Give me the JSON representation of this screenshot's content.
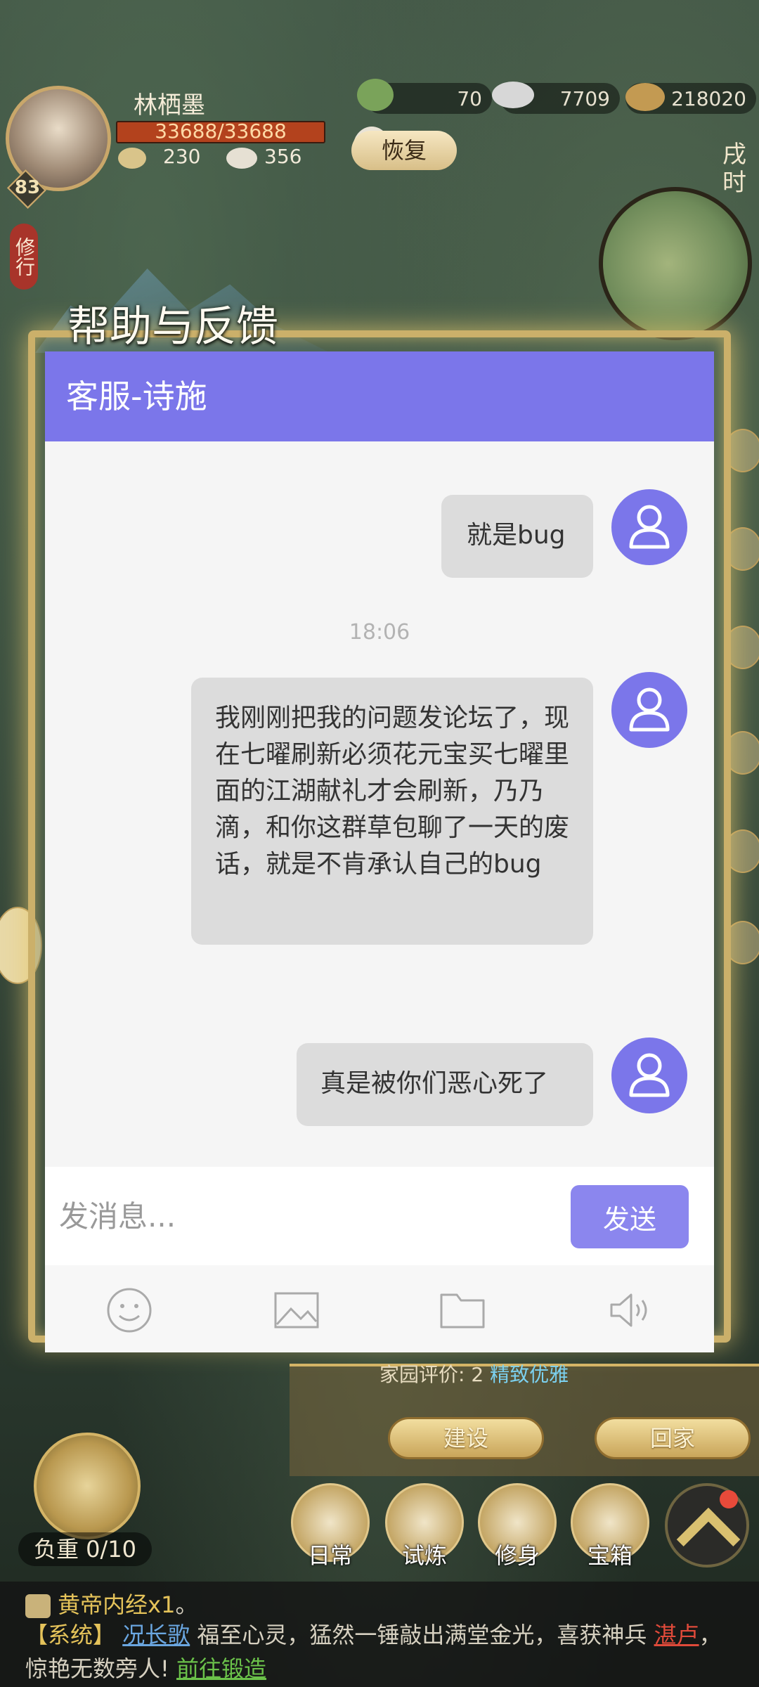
{
  "hud": {
    "player_name": "林栖墨",
    "hp": "33688/33688",
    "level": "83",
    "food": "230",
    "steamed_bun": "356",
    "jade": "70",
    "silver": "7709",
    "copper": "218020",
    "recover_label": "恢复",
    "time_of_day": "戌时",
    "cultivate_tag": "修行"
  },
  "dialog": {
    "title": "帮助与反馈",
    "chat_header": "客服-诗施",
    "messages": [
      {
        "text": "就是bug"
      },
      {
        "text": "我刚刚把我的问题发论坛了，现在七曜刷新必须花元宝买七曜里面的江湖献礼才会刷新，乃乃滴，和你这群草包聊了一天的废话，就是不肯承认自己的bug"
      },
      {
        "text": "真是被你们恶心死了"
      }
    ],
    "timestamp": "18:06",
    "input_placeholder": "发消息...",
    "send_label": "发送",
    "toolbar": [
      "emoji-icon",
      "image-icon",
      "folder-icon",
      "voice-icon"
    ]
  },
  "yard": {
    "info_prefix": "家园评价:",
    "info_count": "2",
    "info_link": "精致优雅",
    "build_label": "建设",
    "home_label": "回家"
  },
  "load": "负重 0/10",
  "nav": [
    {
      "label": "日常"
    },
    {
      "label": "试炼"
    },
    {
      "label": "修身"
    },
    {
      "label": "宝箱"
    }
  ],
  "log": {
    "line1_item": "黄帝内经x1",
    "line1_end": "。",
    "system_tag": "【系统】",
    "player": "况长歌",
    "text1": "福至心灵，猛然一锤敲出满堂金光，喜获神兵",
    "weapon": "湛卢",
    "text2": "，惊艳无数旁人!",
    "action": "前往锻造"
  },
  "colors": {
    "accent": "#7b76ea",
    "bubble": "#dcdcdc",
    "chat_bg": "#f5f5f5",
    "gold": "#cbb06a"
  }
}
